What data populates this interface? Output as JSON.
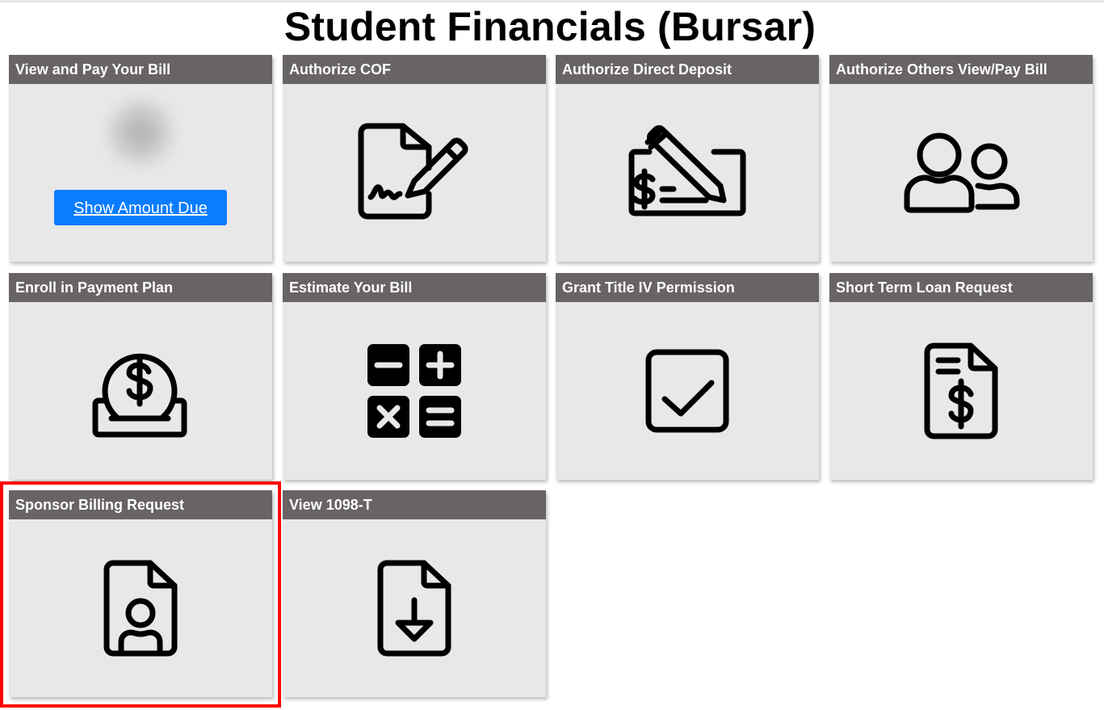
{
  "page": {
    "title": "Student Financials (Bursar)"
  },
  "tiles": [
    {
      "label": "View and Pay Your Bill",
      "icon": "blurred-amount",
      "button_label": "Show Amount Due"
    },
    {
      "label": "Authorize COF",
      "icon": "document-signature-icon"
    },
    {
      "label": "Authorize Direct Deposit",
      "icon": "check-pencil-icon"
    },
    {
      "label": "Authorize Others View/Pay Bill",
      "icon": "users-icon"
    },
    {
      "label": "Enroll in Payment Plan",
      "icon": "coin-deposit-icon"
    },
    {
      "label": "Estimate Your Bill",
      "icon": "calculator-icon"
    },
    {
      "label": "Grant Title IV Permission",
      "icon": "checkbox-checked-icon"
    },
    {
      "label": "Short Term Loan Request",
      "icon": "document-dollar-icon"
    },
    {
      "label": "Sponsor Billing Request",
      "icon": "document-person-icon",
      "highlighted": true
    },
    {
      "label": "View 1098-T",
      "icon": "document-download-icon"
    }
  ],
  "colors": {
    "tile_header": "#686463",
    "tile_body": "#e8e8e8",
    "button": "#0a7cff",
    "highlight": "#ff0000"
  }
}
